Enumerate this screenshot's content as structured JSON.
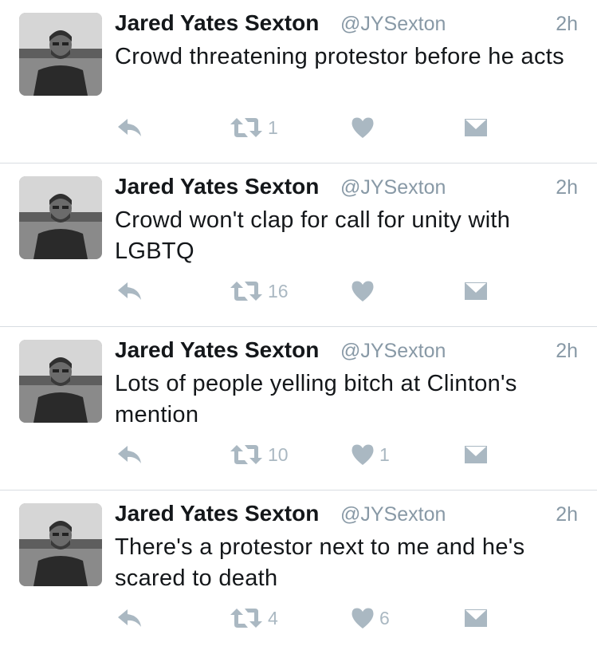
{
  "tweets": [
    {
      "name": "Jared Yates Sexton",
      "handle": "@JYSexton",
      "time": "2h",
      "text": "Crowd threatening protestor before he acts",
      "retweets": "1",
      "likes": ""
    },
    {
      "name": "Jared Yates Sexton",
      "handle": "@JYSexton",
      "time": "2h",
      "text": "Crowd won't clap for call for unity with LGBTQ",
      "retweets": "16",
      "likes": ""
    },
    {
      "name": "Jared Yates Sexton",
      "handle": "@JYSexton",
      "time": "2h",
      "text": "Lots of people yelling bitch at Clinton's mention",
      "retweets": "10",
      "likes": "1"
    },
    {
      "name": "Jared Yates Sexton",
      "handle": "@JYSexton",
      "time": "2h",
      "text": "There's a protestor next to me and he's scared to death",
      "retweets": "4",
      "likes": "6"
    }
  ],
  "colors": {
    "name": "#14171a",
    "meta": "#8899a6",
    "action": "#aab8c2",
    "divider": "#d8dde2"
  },
  "icons": {
    "reply": "reply-icon",
    "retweet": "retweet-icon",
    "like": "heart-icon",
    "dm": "envelope-icon"
  }
}
